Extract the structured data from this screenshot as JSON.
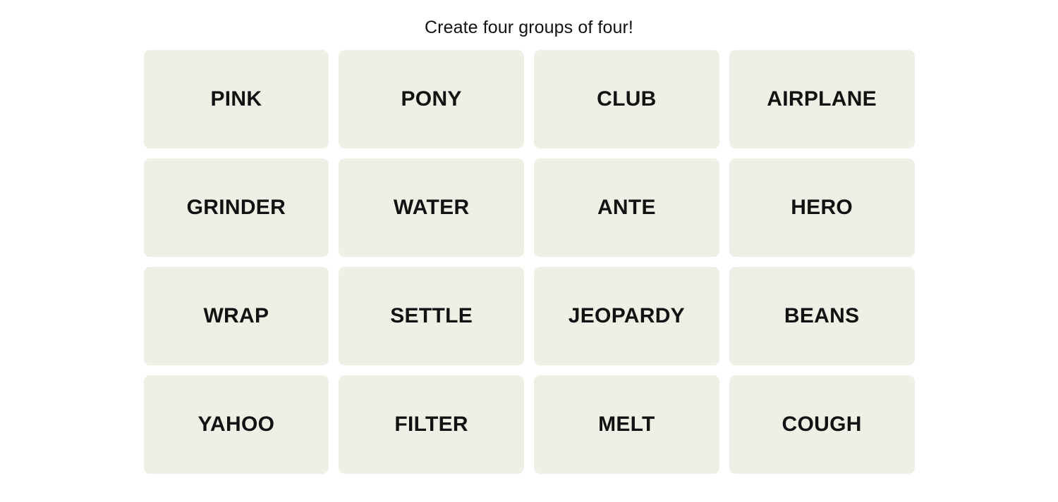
{
  "page": {
    "background_color": "#ffffff",
    "text_color": "#121212"
  },
  "header": {
    "instruction": "Create four groups of four!"
  },
  "board": {
    "rows": 4,
    "columns": 4,
    "tile_color": "#efefe6",
    "tile_text_color": "#121212",
    "tiles": [
      {
        "label": "PINK",
        "row": 1,
        "col": 1,
        "selected": false
      },
      {
        "label": "PONY",
        "row": 1,
        "col": 2,
        "selected": false
      },
      {
        "label": "CLUB",
        "row": 1,
        "col": 3,
        "selected": false
      },
      {
        "label": "AIRPLANE",
        "row": 1,
        "col": 4,
        "selected": false
      },
      {
        "label": "GRINDER",
        "row": 2,
        "col": 1,
        "selected": false
      },
      {
        "label": "WATER",
        "row": 2,
        "col": 2,
        "selected": false
      },
      {
        "label": "ANTE",
        "row": 2,
        "col": 3,
        "selected": false
      },
      {
        "label": "HERO",
        "row": 2,
        "col": 4,
        "selected": false
      },
      {
        "label": "WRAP",
        "row": 3,
        "col": 1,
        "selected": false
      },
      {
        "label": "SETTLE",
        "row": 3,
        "col": 2,
        "selected": false
      },
      {
        "label": "JEOPARDY",
        "row": 3,
        "col": 3,
        "selected": false
      },
      {
        "label": "BEANS",
        "row": 3,
        "col": 4,
        "selected": false
      },
      {
        "label": "YAHOO",
        "row": 4,
        "col": 1,
        "selected": false
      },
      {
        "label": "FILTER",
        "row": 4,
        "col": 2,
        "selected": false
      },
      {
        "label": "MELT",
        "row": 4,
        "col": 3,
        "selected": false
      },
      {
        "label": "COUGH",
        "row": 4,
        "col": 4,
        "selected": false
      }
    ]
  }
}
